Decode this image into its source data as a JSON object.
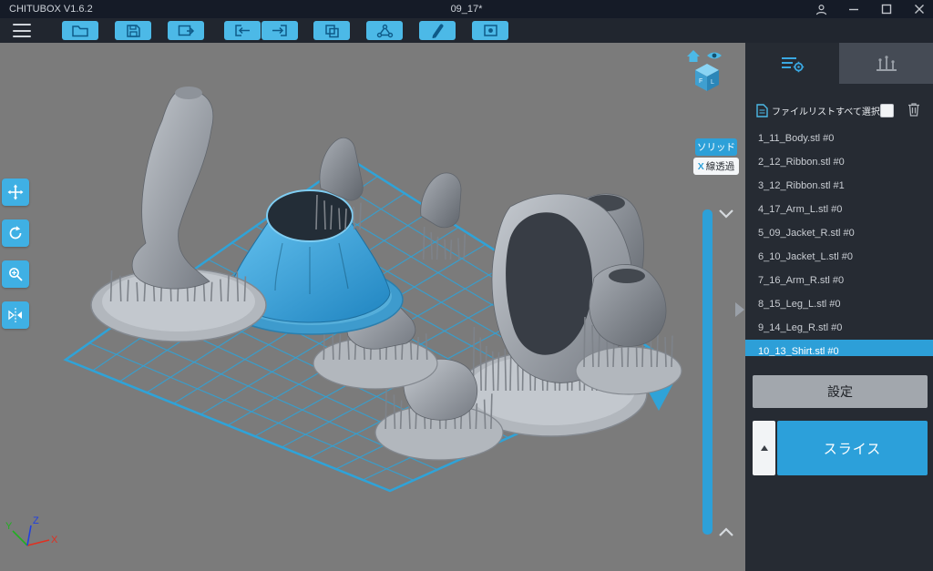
{
  "titlebar": {
    "app_title": "CHITUBOX V1.6.2",
    "document_title": "09_17*"
  },
  "toolbar": {
    "buttons": [
      "open",
      "save",
      "screenshot",
      "move-in",
      "move-out",
      "copy",
      "support-edit",
      "hollow",
      "dig-hole"
    ]
  },
  "left_tools": [
    "move",
    "rotate",
    "scale",
    "mirror"
  ],
  "viewport": {
    "render_modes": {
      "solid": "ソリッド",
      "xray_x": "X",
      "xray": "線透過"
    },
    "gizmo": {
      "front_letter": "F",
      "left_letter": "L"
    },
    "axes": {
      "x": "X",
      "y": "Y",
      "z": "Z"
    },
    "axis_colors": {
      "x": "#e03020",
      "y": "#20b020",
      "z": "#2040e0"
    }
  },
  "right_panel": {
    "tabs": [
      "settings",
      "support"
    ],
    "file_list": {
      "select_all_label": "ファイルリストすべて選択",
      "files": [
        "1_11_Body.stl #0",
        "2_12_Ribbon.stl #0",
        "3_12_Ribbon.stl #1",
        "4_17_Arm_L.stl #0",
        "5_09_Jacket_R.stl #0",
        "6_10_Jacket_L.stl #0",
        "7_16_Arm_R.stl #0",
        "8_15_Leg_L.stl #0",
        "9_14_Leg_R.stl #0",
        "10_13_Shirt.stl #0"
      ],
      "selected_index": 9
    },
    "settings_button": "設定",
    "slice_button": "スライス"
  },
  "colors": {
    "accent": "#2da0d8",
    "toolbar_button": "#4cb9e7",
    "selected_model": "#3aa8e2",
    "plate_grid": "#2fa3d8"
  }
}
